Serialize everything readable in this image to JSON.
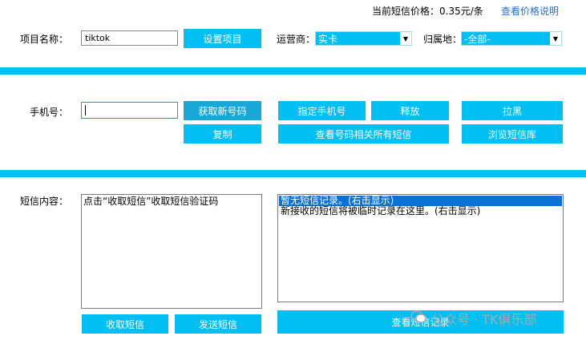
{
  "header": {
    "price_label": "当前短信价格：",
    "price_value": "0.35元/条",
    "price_help_link": "查看价格说明"
  },
  "project": {
    "label": "项目名称：",
    "value": "tiktok",
    "set_button": "设置项目",
    "carrier_label": "运营商：",
    "carrier_value": "实卡",
    "region_label": "归属地：",
    "region_value": "-全部-"
  },
  "phone": {
    "label": "手机号：",
    "value": "",
    "get_new_button": "获取新号码",
    "specify_button": "指定手机号",
    "release_button": "释放",
    "blacklist_button": "拉黑",
    "copy_button": "复制",
    "view_all_button": "查看号码相关所有短信",
    "browse_button": "浏览短信库"
  },
  "sms": {
    "label": "短信内容：",
    "content_text": "点击“收取短信”收取短信验证码",
    "log_rows": [
      "暂无短信记录。(右击显示)",
      "新接收的短信将被临时记录在这里。(右击显示)"
    ],
    "receive_button": "收取短信",
    "send_button": "发送短信",
    "view_log_button": "查看短信记录"
  },
  "watermark": {
    "text": "公众号 · TK俱乐部"
  }
}
